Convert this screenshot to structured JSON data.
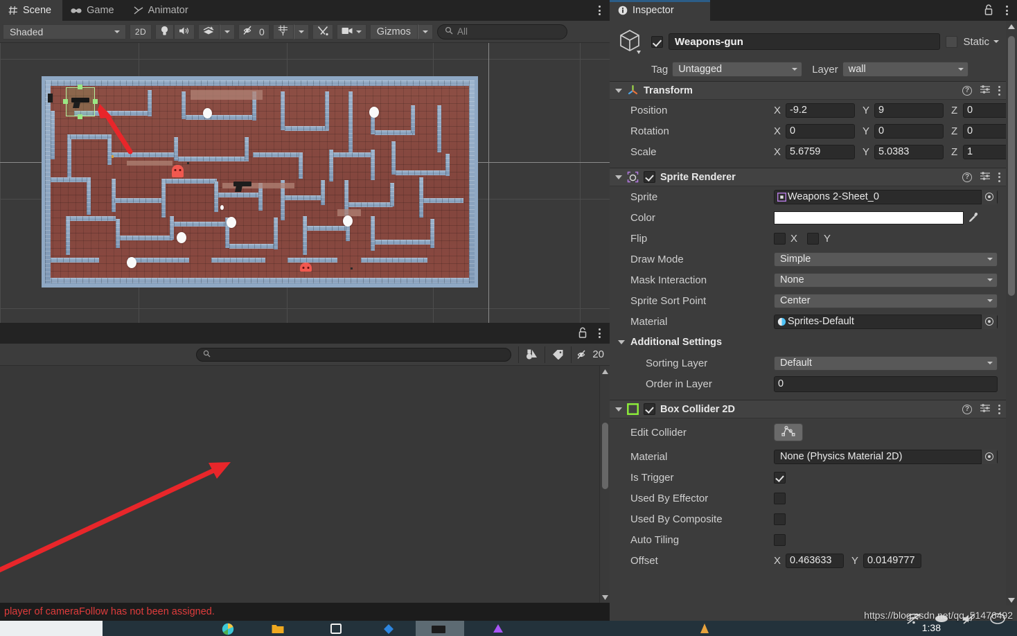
{
  "scene_panel": {
    "tabs": [
      {
        "label": "Scene",
        "icon": "grid-icon",
        "active": true
      },
      {
        "label": "Game",
        "icon": "gamepad-icon",
        "active": false
      },
      {
        "label": "Animator",
        "icon": "animator-icon",
        "active": false
      }
    ],
    "toolbar": {
      "shading_mode": "Shaded",
      "mode_2d": "2D",
      "lighting_icon": "lightbulb-icon",
      "audio_icon": "speaker-icon",
      "fx_icon": "effects-icon",
      "hidden_objects_count": "0",
      "grid_icon": "grid-axis-icon",
      "tools_icon": "tools-icon",
      "camera_icon": "camera-icon",
      "gizmos_label": "Gizmos",
      "search_placeholder": "All",
      "search_value": ""
    },
    "overflow_icon": "kebab-menu-icon"
  },
  "console_panel": {
    "lock_icon": "lock-icon",
    "overflow_icon": "kebab-menu-icon",
    "search_value": "",
    "search_icon": "search-icon",
    "buttons": [
      {
        "name": "object-filter-icon",
        "label": ""
      },
      {
        "name": "tag-filter-icon",
        "label": ""
      },
      {
        "name": "hidden-count-icon",
        "label": "20"
      }
    ],
    "status_message": "player of cameraFollow has not been assigned."
  },
  "inspector": {
    "tab_label": "Inspector",
    "tab_icon": "info-icon",
    "lock_icon": "lock-icon",
    "overflow_icon": "kebab-menu-icon",
    "game_object": {
      "icon": "cube-icon",
      "enabled": true,
      "name": "Weapons-gun",
      "static_label": "Static",
      "static_checked": false,
      "tag_label": "Tag",
      "tag_value": "Untagged",
      "layer_label": "Layer",
      "layer_value": "wall"
    },
    "components": [
      {
        "title": "Transform",
        "icon": "transform-icon",
        "has_checkbox": false,
        "rows": [
          {
            "label": "Position",
            "type": "vector3",
            "x": "-9.2",
            "y": "9",
            "z": "0"
          },
          {
            "label": "Rotation",
            "type": "vector3",
            "x": "0",
            "y": "0",
            "z": "0"
          },
          {
            "label": "Scale",
            "type": "vector3",
            "x": "5.6759",
            "y": "5.0383",
            "z": "1"
          }
        ]
      },
      {
        "title": "Sprite Renderer",
        "icon": "sprite-renderer-icon",
        "has_checkbox": true,
        "enabled": true,
        "rows": [
          {
            "label": "Sprite",
            "type": "object",
            "value": "Weapons 2-Sheet_0",
            "thumb": "sprite-thumb-icon"
          },
          {
            "label": "Color",
            "type": "color",
            "value": "#FFFFFF",
            "eyedropper": "eyedropper-icon"
          },
          {
            "label": "Flip",
            "type": "flip",
            "x_label": "X",
            "y_label": "Y",
            "x_checked": false,
            "y_checked": false
          },
          {
            "label": "Draw Mode",
            "type": "dropdown",
            "value": "Simple"
          },
          {
            "label": "Mask Interaction",
            "type": "dropdown",
            "value": "None"
          },
          {
            "label": "Sprite Sort Point",
            "type": "dropdown",
            "value": "Center"
          },
          {
            "label": "Material",
            "type": "object",
            "value": "Sprites-Default",
            "thumb": "material-thumb-icon"
          },
          {
            "label": "Additional Settings",
            "type": "subheader"
          },
          {
            "label": "Sorting Layer",
            "type": "dropdown",
            "value": "Default",
            "indent": true
          },
          {
            "label": "Order in Layer",
            "type": "text",
            "value": "0",
            "indent": true
          }
        ]
      },
      {
        "title": "Box Collider 2D",
        "icon": "box-collider-icon",
        "has_checkbox": true,
        "enabled": true,
        "rows": [
          {
            "label": "Edit Collider",
            "type": "button",
            "icon": "edit-collider-icon"
          },
          {
            "label": "Material",
            "type": "object",
            "value": "None (Physics Material 2D)"
          },
          {
            "label": "Is Trigger",
            "type": "checkbox",
            "checked": true
          },
          {
            "label": "Used By Effector",
            "type": "checkbox",
            "checked": false
          },
          {
            "label": "Used By Composite",
            "type": "checkbox",
            "checked": false
          },
          {
            "label": "Auto Tiling",
            "type": "checkbox",
            "checked": false
          },
          {
            "label": "Offset",
            "type": "vector2",
            "x": "0.463633",
            "y": "0.0149777"
          }
        ]
      }
    ]
  },
  "overlay": {
    "watermark": "https://blog.csdn.net/qq_51476492",
    "clock": "1:38"
  },
  "scene_content": {
    "description": "2D pixel maze level with brick walls, pellets, ghost enemies and gun pickups",
    "selected_object": "Weapons-gun",
    "annotation_arrows": 2,
    "arrow_color": "#E8262A",
    "pellets": 7,
    "ghosts": 3,
    "guns": 3
  },
  "colors": {
    "panel_bg": "#3c3c3c",
    "tab_bg": "#232323",
    "field_bg": "#2b2b2b",
    "accent_blue": "#2c5d87",
    "error_red": "#e03c3c",
    "collider_green": "#9ae884"
  }
}
